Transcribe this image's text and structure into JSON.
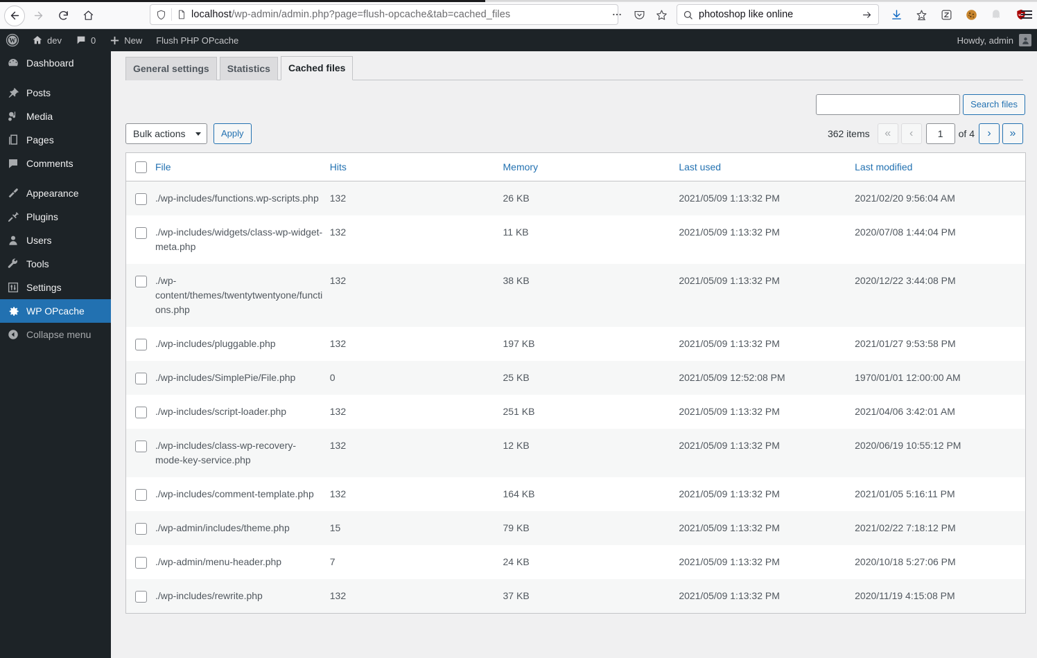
{
  "browser": {
    "url_host": "localhost",
    "url_path": "/wp-admin/admin.php?page=flush-opcache&tab=cached_files",
    "search_query": "photoshop like online",
    "back_icon": "back-arrow-icon",
    "forward_icon": "forward-arrow-icon",
    "reload_icon": "reload-icon",
    "home_icon": "home-icon",
    "shield_icon": "shield-icon",
    "page_icon": "page-icon",
    "ellipsis_icon": "ellipsis-icon",
    "pocket_icon": "pocket-icon",
    "bookmark_icon": "star-bookmark-icon",
    "downloads_icon": "download-icon",
    "save_to_pocket_icon": "save-star-icon",
    "zotero_icon": "zotero-icon",
    "cookie_icon": "cookie-icon",
    "ghost_icon": "ghostery-icon",
    "ublock_icon": "ublock-origin-icon",
    "menu_icon": "hamburger-menu-icon"
  },
  "adminbar": {
    "logo": "wordpress-logo-icon",
    "site_name": "dev",
    "site_icon": "home-icon",
    "comments_count": "0",
    "comments_icon": "comment-bubble-icon",
    "new_label": "New",
    "new_icon": "plus-icon",
    "page_title": "Flush PHP OPcache",
    "howdy": "Howdy, admin",
    "avatar": "user-avatar-icon"
  },
  "sidebar": {
    "items": [
      {
        "label": "Dashboard",
        "icon": "dashboard-icon",
        "current": false
      },
      {
        "label": "Posts",
        "icon": "pin-icon",
        "current": false
      },
      {
        "label": "Media",
        "icon": "media-icon",
        "current": false
      },
      {
        "label": "Pages",
        "icon": "pages-icon",
        "current": false
      },
      {
        "label": "Comments",
        "icon": "comment-icon",
        "current": false
      },
      {
        "label": "Appearance",
        "icon": "paintbrush-icon",
        "current": false
      },
      {
        "label": "Plugins",
        "icon": "plug-icon",
        "current": false
      },
      {
        "label": "Users",
        "icon": "user-icon",
        "current": false
      },
      {
        "label": "Tools",
        "icon": "wrench-icon",
        "current": false
      },
      {
        "label": "Settings",
        "icon": "sliders-icon",
        "current": false
      },
      {
        "label": "WP OPcache",
        "icon": "gear-icon",
        "current": true
      }
    ],
    "collapse": {
      "label": "Collapse menu",
      "icon": "collapse-arrow-icon"
    }
  },
  "tabs": [
    {
      "label": "General settings",
      "active": false
    },
    {
      "label": "Statistics",
      "active": false
    },
    {
      "label": "Cached files",
      "active": true
    }
  ],
  "search": {
    "value": "",
    "placeholder": "",
    "button_label": "Search files"
  },
  "toolbar": {
    "bulk_actions_label": "Bulk actions",
    "apply_label": "Apply"
  },
  "pagination": {
    "items_text": "362 items",
    "first_label": "«",
    "prev_label": "‹",
    "current_page": "1",
    "of_label": "of 4",
    "next_label": "›",
    "last_label": "»"
  },
  "table": {
    "columns": [
      "File",
      "Hits",
      "Memory",
      "Last used",
      "Last modified"
    ],
    "rows": [
      {
        "file": "./wp-includes/functions.wp-scripts.php",
        "hits": "132",
        "memory": "26 KB",
        "last_used": "2021/05/09 1:13:32 PM",
        "last_modified": "2021/02/20 9:56:04 AM"
      },
      {
        "file": "./wp-includes/widgets/class-wp-widget-meta.php",
        "hits": "132",
        "memory": "11 KB",
        "last_used": "2021/05/09 1:13:32 PM",
        "last_modified": "2020/07/08 1:44:04 PM"
      },
      {
        "file": "./wp-content/themes/twentytwentyone/functions.php",
        "hits": "132",
        "memory": "38 KB",
        "last_used": "2021/05/09 1:13:32 PM",
        "last_modified": "2020/12/22 3:44:08 PM"
      },
      {
        "file": "./wp-includes/pluggable.php",
        "hits": "132",
        "memory": "197 KB",
        "last_used": "2021/05/09 1:13:32 PM",
        "last_modified": "2021/01/27 9:53:58 PM"
      },
      {
        "file": "./wp-includes/SimplePie/File.php",
        "hits": "0",
        "memory": "25 KB",
        "last_used": "2021/05/09 12:52:08 PM",
        "last_modified": "1970/01/01 12:00:00 AM"
      },
      {
        "file": "./wp-includes/script-loader.php",
        "hits": "132",
        "memory": "251 KB",
        "last_used": "2021/05/09 1:13:32 PM",
        "last_modified": "2021/04/06 3:42:01 AM"
      },
      {
        "file": "./wp-includes/class-wp-recovery-mode-key-service.php",
        "hits": "132",
        "memory": "12 KB",
        "last_used": "2021/05/09 1:13:32 PM",
        "last_modified": "2020/06/19 10:55:12 PM"
      },
      {
        "file": "./wp-includes/comment-template.php",
        "hits": "132",
        "memory": "164 KB",
        "last_used": "2021/05/09 1:13:32 PM",
        "last_modified": "2021/01/05 5:16:11 PM"
      },
      {
        "file": "./wp-admin/includes/theme.php",
        "hits": "15",
        "memory": "79 KB",
        "last_used": "2021/05/09 1:13:32 PM",
        "last_modified": "2021/02/22 7:18:12 PM"
      },
      {
        "file": "./wp-admin/menu-header.php",
        "hits": "7",
        "memory": "24 KB",
        "last_used": "2021/05/09 1:13:32 PM",
        "last_modified": "2020/10/18 5:27:06 PM"
      },
      {
        "file": "./wp-includes/rewrite.php",
        "hits": "132",
        "memory": "37 KB",
        "last_used": "2021/05/09 1:13:32 PM",
        "last_modified": "2020/11/19 4:15:08 PM"
      }
    ]
  },
  "colors": {
    "wp_blue": "#2271b1",
    "sidebar_bg": "#1d2327",
    "admin_bg": "#f0f0f1",
    "link": "#2271b1",
    "alt_row": "#f6f7f7"
  }
}
